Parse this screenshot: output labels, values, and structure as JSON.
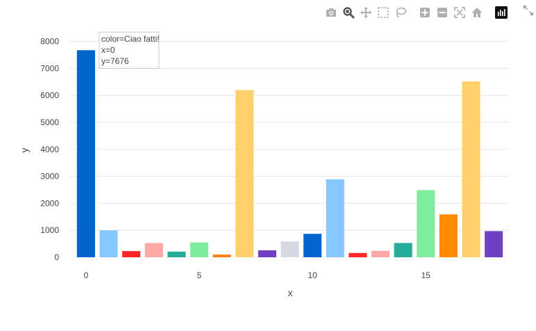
{
  "toolbar": {
    "buttons": [
      {
        "name": "camera-icon",
        "active": false
      },
      {
        "name": "zoom-icon",
        "active": true
      },
      {
        "name": "pan-icon",
        "active": false
      },
      {
        "name": "box-select-icon",
        "active": false
      },
      {
        "name": "lasso-select-icon",
        "active": false
      },
      {
        "name": "zoom-in-icon",
        "active": false
      },
      {
        "name": "zoom-out-icon",
        "active": false
      },
      {
        "name": "autoscale-icon",
        "active": false
      },
      {
        "name": "reset-axes-icon",
        "active": false
      },
      {
        "name": "plotly-logo-icon",
        "active": false
      }
    ],
    "expand_icon": "expand-icon"
  },
  "colors": {
    "grid": "#e6e6e6",
    "tick_text": "#444444",
    "icon": "#b0b0b0",
    "icon_active": "#555555"
  },
  "chart_data": {
    "type": "bar",
    "xlabel": "x",
    "ylabel": "y",
    "xlim": [
      -0.7,
      18.7
    ],
    "ylim": [
      0,
      8300
    ],
    "x_ticks": [
      0,
      5,
      10,
      15
    ],
    "y_ticks": [
      0,
      1000,
      2000,
      3000,
      4000,
      5000,
      6000,
      7000,
      8000
    ],
    "grid": true,
    "legend": "none",
    "bars": [
      {
        "x": 0,
        "value": 7676,
        "color": "#0066CC"
      },
      {
        "x": 1,
        "value": 1000,
        "color": "#85C7FF"
      },
      {
        "x": 2,
        "value": 230,
        "color": "#FF2626"
      },
      {
        "x": 3,
        "value": 530,
        "color": "#FFA8A8"
      },
      {
        "x": 4,
        "value": 210,
        "color": "#24AD9A"
      },
      {
        "x": 5,
        "value": 550,
        "color": "#7FED9E"
      },
      {
        "x": 6,
        "value": 100,
        "color": "#FF7F0E"
      },
      {
        "x": 7,
        "value": 6200,
        "color": "#FFD16E"
      },
      {
        "x": 8,
        "value": 260,
        "color": "#6F3FC4"
      },
      {
        "x": 9,
        "value": 590,
        "color": "#D5DAE5"
      },
      {
        "x": 10,
        "value": 870,
        "color": "#0066CC"
      },
      {
        "x": 11,
        "value": 2890,
        "color": "#85C7FF"
      },
      {
        "x": 12,
        "value": 160,
        "color": "#FF2626"
      },
      {
        "x": 13,
        "value": 240,
        "color": "#FFA8A8"
      },
      {
        "x": 14,
        "value": 530,
        "color": "#24AD9A"
      },
      {
        "x": 15,
        "value": 2490,
        "color": "#7FED9E"
      },
      {
        "x": 16,
        "value": 1590,
        "color": "#FF8C00"
      },
      {
        "x": 17,
        "value": 6520,
        "color": "#FFD16E"
      },
      {
        "x": 18,
        "value": 970,
        "color": "#6F3FC4"
      }
    ],
    "hover": {
      "x": 0,
      "value": 7676,
      "lines": [
        "color=Ciao fatti!",
        "x=0",
        "y=7676"
      ]
    }
  }
}
